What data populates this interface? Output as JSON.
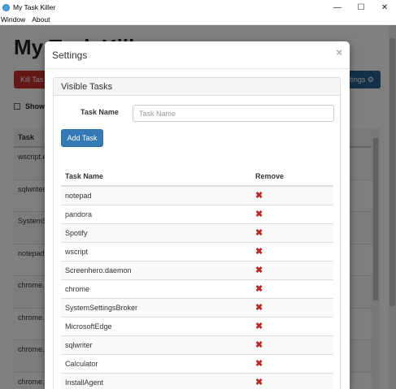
{
  "window": {
    "title": "My Task Killer",
    "controls": {
      "minimize": "—",
      "maximize": "☐",
      "close": "✕"
    }
  },
  "menu": [
    "Window",
    "About"
  ],
  "app": {
    "heading": "My Task Kill",
    "kill_button": "Kill Tas",
    "settings_button": "ttings ⚙",
    "show_label": "Show",
    "table_header": "Task",
    "rows": [
      "wscript.e",
      "sqlwriter",
      "SystemS",
      "notepad",
      "chrome.",
      "chrome.",
      "chrome.",
      "chrome."
    ]
  },
  "modal": {
    "title": "Settings",
    "close_symbol": "×",
    "panel_title": "Visible Tasks",
    "task_name_label": "Task Name",
    "task_name_placeholder": "Task Name",
    "add_button": "Add Task",
    "columns": {
      "name": "Task Name",
      "remove": "Remove"
    },
    "remove_symbol": "✖",
    "tasks": [
      "notepad",
      "pandora",
      "Spotify",
      "wscript",
      "Screenhero.daemon",
      "chrome",
      "SystemSettingsBroker",
      "MicrosoftEdge",
      "sqlwriter",
      "Calculator",
      "InstallAgent"
    ]
  }
}
